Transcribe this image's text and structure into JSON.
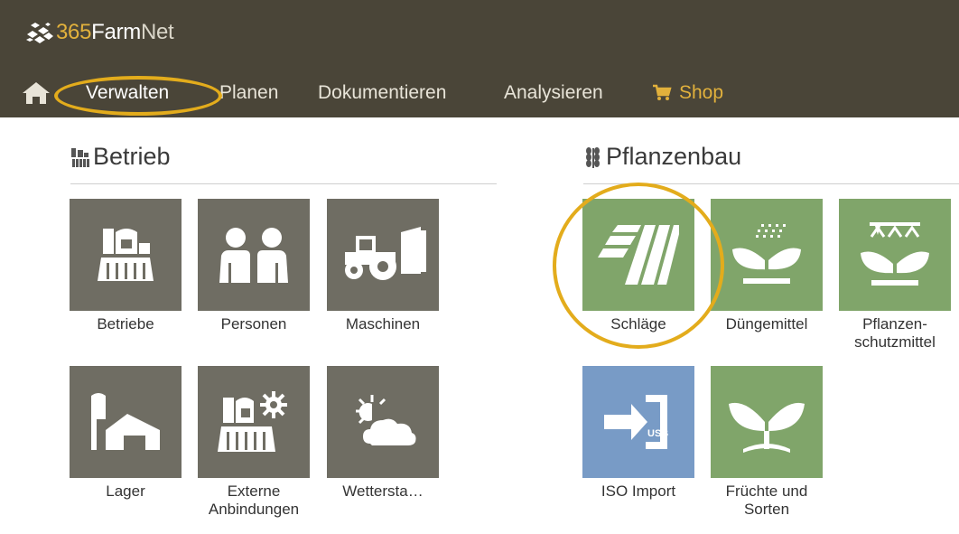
{
  "app": {
    "logo_prefix": "365",
    "logo_farm": "Farm",
    "logo_net": "Net"
  },
  "nav": {
    "items": [
      {
        "label": "Verwalten"
      },
      {
        "label": "Planen"
      },
      {
        "label": "Dokumentieren"
      },
      {
        "label": "Analysieren"
      },
      {
        "label": "Shop"
      }
    ]
  },
  "sections": {
    "betrieb": {
      "title": "Betrieb",
      "tiles": [
        {
          "label": "Betriebe",
          "icon": "farm-buildings-icon"
        },
        {
          "label": "Personen",
          "icon": "persons-icon"
        },
        {
          "label": "Maschinen",
          "icon": "tractor-icon"
        },
        {
          "label": "Lager",
          "icon": "storage-icon"
        },
        {
          "label": "Externe Anbindungen",
          "icon": "external-connections-icon"
        },
        {
          "label": "Wettersta…",
          "icon": "weather-icon"
        }
      ]
    },
    "pflanzenbau": {
      "title": "Pflanzenbau",
      "tiles": [
        {
          "label": "Schläge",
          "icon": "fields-icon"
        },
        {
          "label": "Düngemittel",
          "icon": "fertilizer-icon"
        },
        {
          "label": "Pflanzen-schutzmittel",
          "icon": "crop-protection-icon"
        },
        {
          "label": "ISO Import",
          "icon": "usb-import-icon"
        },
        {
          "label": "Früchte und Sorten",
          "icon": "crops-varieties-icon"
        }
      ]
    }
  },
  "colors": {
    "header_bg": "#4a4538",
    "accent": "#e2b13c",
    "highlight": "#e3ac1c",
    "tile_gray": "#6f6d63",
    "tile_green": "#80a56a",
    "tile_blue": "#789bc6"
  }
}
